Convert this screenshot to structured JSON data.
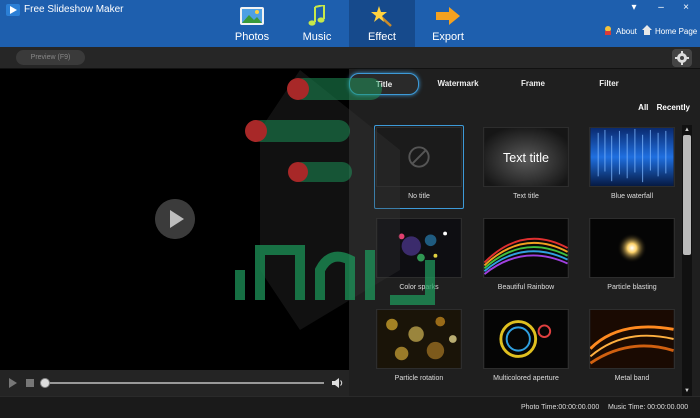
{
  "app": {
    "title": "Free Slideshow Maker"
  },
  "nav": {
    "tabs": [
      {
        "label": "Photos",
        "icon": "photos-icon"
      },
      {
        "label": "Music",
        "icon": "music-icon"
      },
      {
        "label": "Effect",
        "icon": "effect-icon",
        "active": true
      },
      {
        "label": "Export",
        "icon": "export-icon"
      }
    ],
    "about_label": "About",
    "home_label": "Home Page"
  },
  "window_controls": {
    "minimize": "–",
    "close": "×",
    "menu": "▾"
  },
  "toolbar": {
    "preview_label": "Preview (F9)"
  },
  "player": {
    "progress": 0
  },
  "effects_panel": {
    "tabs": [
      {
        "label": "Title",
        "active": true
      },
      {
        "label": "Watermark"
      },
      {
        "label": "Frame"
      },
      {
        "label": "Filter"
      }
    ],
    "filter_all": "All",
    "filter_recently": "Recently",
    "text_title_sample": "Text title",
    "items": [
      {
        "label": "No title",
        "selected": true
      },
      {
        "label": "Text title"
      },
      {
        "label": "Blue waterfall"
      },
      {
        "label": "Color sparks"
      },
      {
        "label": "Beautiful Rainbow"
      },
      {
        "label": "Particle blasting"
      },
      {
        "label": "Particle rotation"
      },
      {
        "label": "Multicolored aperture"
      },
      {
        "label": "Metal band"
      }
    ]
  },
  "status": {
    "photo_time": "Photo Time:00:00:00.000",
    "music_time": "Music Time:  00:00:00.000"
  },
  "colors": {
    "accent": "#3d9ad8",
    "topbar": "#1e5fae",
    "watermark_red": "#c62f2f",
    "watermark_green": "#1f9a5d"
  }
}
